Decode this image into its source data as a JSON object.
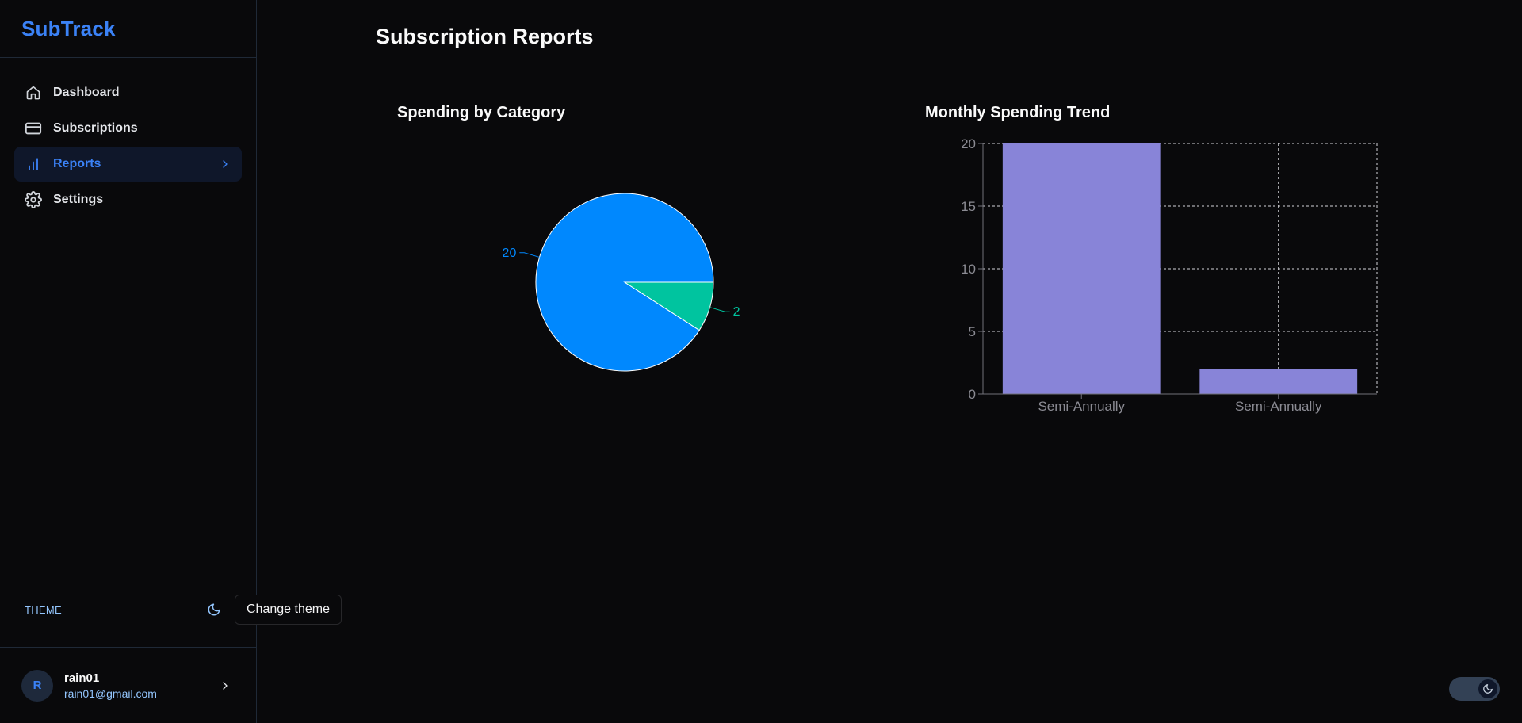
{
  "app": {
    "brand": "SubTrack",
    "page_title": "Subscription Reports"
  },
  "sidebar": {
    "items": [
      {
        "label": "Dashboard",
        "icon": "home-icon",
        "active": false
      },
      {
        "label": "Subscriptions",
        "icon": "credit-card-icon",
        "active": false
      },
      {
        "label": "Reports",
        "icon": "bar-chart-icon",
        "active": true
      },
      {
        "label": "Settings",
        "icon": "gear-icon",
        "active": false
      }
    ],
    "theme_label": "THEME",
    "theme_tooltip": "Change theme"
  },
  "user": {
    "initial": "R",
    "name": "rain01",
    "email": "rain01@gmail.com"
  },
  "colors": {
    "accent": "#3b82f6",
    "pie_slices": [
      "#0088fe",
      "#00c49f"
    ],
    "bar_fill": "#8884d8"
  },
  "chart_data": [
    {
      "type": "pie",
      "title": "Spending by Category",
      "slices": [
        {
          "label": "20",
          "value": 20
        },
        {
          "label": "2",
          "value": 2
        }
      ]
    },
    {
      "type": "bar",
      "title": "Monthly Spending Trend",
      "categories": [
        "Semi-Annually",
        "Semi-Annually"
      ],
      "values": [
        20,
        2
      ],
      "ylim": [
        0,
        20
      ],
      "yticks": [
        0,
        5,
        10,
        15,
        20
      ],
      "grid": true
    }
  ]
}
